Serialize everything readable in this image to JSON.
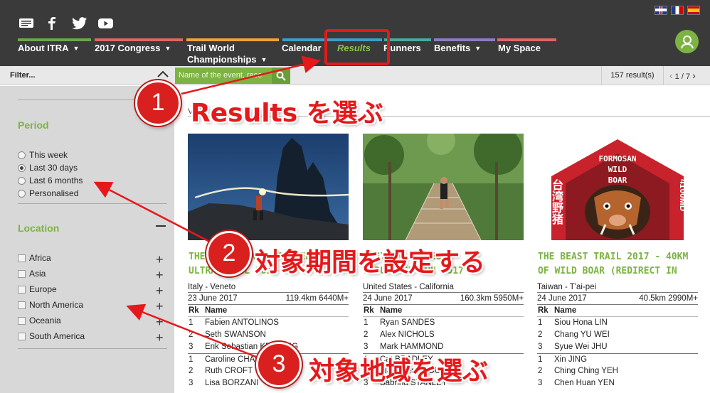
{
  "header": {
    "social": [
      "blog-icon",
      "facebook-icon",
      "twitter-icon",
      "youtube-icon"
    ],
    "languages": [
      "English",
      "Français",
      "Español"
    ],
    "nav": [
      {
        "label": "About ITRA",
        "caret": "▼",
        "color": "#6aa84f"
      },
      {
        "label": "2017 Congress",
        "caret": "▼",
        "color": "#e06666"
      },
      {
        "label": "Trail World",
        "label2": "Championships",
        "caret": "▼",
        "color": "#f1a33a"
      },
      {
        "label": "Calendar",
        "caret": "",
        "color": "#3d9fc9"
      },
      {
        "label": "Results",
        "caret": "",
        "color": "#3d9fc9"
      },
      {
        "label": "Runners",
        "caret": "",
        "color": "#4aa9a0"
      },
      {
        "label": "Benefits",
        "caret": "▼",
        "color": "#8e7cc3"
      },
      {
        "label": "My Space",
        "caret": "",
        "color": "#e06666"
      }
    ]
  },
  "filter": {
    "label": "Filter...",
    "search_placeholder": "Name of the event, race",
    "result_count": "157 result(s)",
    "pager": "1 / 7"
  },
  "sidebar": {
    "period": {
      "title": "Period",
      "options": [
        {
          "label": "This week",
          "selected": false
        },
        {
          "label": "Last 30 days",
          "selected": true
        },
        {
          "label": "Last 6 months",
          "selected": false
        },
        {
          "label": "Personalised",
          "selected": false
        }
      ]
    },
    "location": {
      "title": "Location",
      "options": [
        "Africa",
        "Asia",
        "Europe",
        "North America",
        "Oceania",
        "South America"
      ]
    }
  },
  "main": {
    "breadcrumb": "V                                  17",
    "col_rank": "Rk",
    "col_name": "Name",
    "cards": [
      {
        "title_line1": "THE NORTH FACE LAVAREDO",
        "title_line2": "ULTRA TRAIL 2017",
        "location": "Italy - Veneto",
        "date": "23 June 2017",
        "distance": "119.4km 6440M+",
        "results": [
          {
            "rk": "1",
            "name": "Fabien ANTOLINOS"
          },
          {
            "rk": "2",
            "name": "Seth SWANSON"
          },
          {
            "rk": "3",
            "name": "Erik Sebastian KROOVIG"
          },
          {
            "rk": "1",
            "name": "Caroline CHAVEROT",
            "sep": true
          },
          {
            "rk": "2",
            "name": "Ruth CROFT"
          },
          {
            "rk": "3",
            "name": "Lisa BORZANI"
          }
        ]
      },
      {
        "title_line1": "WESTERN STATES",
        "title_line2": "ENDURANCE RUN 2017",
        "location": "United States - California",
        "date": "24 June 2017",
        "distance": "160.3km 5950M+",
        "results": [
          {
            "rk": "1",
            "name": "Ryan SANDES"
          },
          {
            "rk": "2",
            "name": "Alex NICHOLS"
          },
          {
            "rk": "3",
            "name": "Mark HAMMOND"
          },
          {
            "rk": "1",
            "name": "Cat BRADLEY",
            "sep": true
          },
          {
            "rk": "2",
            "name": "Magdalena BOULET"
          },
          {
            "rk": "3",
            "name": "Sabrina STANLEY"
          }
        ]
      },
      {
        "title_line1": "THE BEAST TRAIL 2017 - 40KM",
        "title_line2": "OF WILD BOAR (REDIRECT IN",
        "location": "Taiwan - T'ai-pei",
        "date": "24 June 2017",
        "distance": "40.5km 2990M+",
        "results": [
          {
            "rk": "1",
            "name": "Siou Hona LIN"
          },
          {
            "rk": "2",
            "name": "Chang YU WEI"
          },
          {
            "rk": "3",
            "name": "Syue Wei JHU"
          },
          {
            "rk": "1",
            "name": "Xin JING",
            "sep": true
          },
          {
            "rk": "2",
            "name": "Ching Ching YEH"
          },
          {
            "rk": "3",
            "name": "Chen Huan YEN"
          }
        ]
      }
    ],
    "poster": {
      "line1": "FORMOSAN",
      "line2": "WILD",
      "line3": "BOAR",
      "vertical_cn": "台湾野猪",
      "vertical_num": "4100MD"
    }
  },
  "annotations": [
    {
      "number": "1",
      "text": "Results を選ぶ"
    },
    {
      "number": "2",
      "text": "対象期間を設定する"
    },
    {
      "number": "3",
      "text": "対象地域を選ぶ"
    }
  ],
  "colors": {
    "accent_green": "#7cb342",
    "annotation_red": "#e5191c",
    "header_bg": "#3a3a3a"
  }
}
